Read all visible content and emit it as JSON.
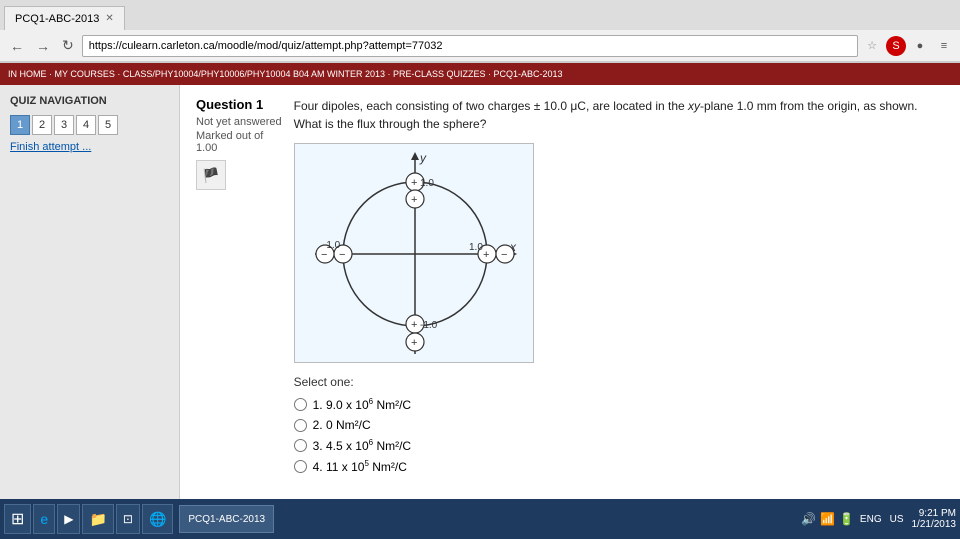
{
  "browser": {
    "tab_title": "PCQ1-ABC-2013",
    "url": "https://culearn.carleton.ca/moodle/mod/quiz/attempt.php?attempt=77032"
  },
  "breadcrumb": {
    "text": "IN HOME  ·  MY COURSES  ·  CLASS/PHY10004/PHY10006/PHY10004 B04 AM WINTER 2013  ·  PRE-CLASS QUIZZES  ·  PCQ1-ABC-2013"
  },
  "sidebar": {
    "title": "QUIZ NAVIGATION",
    "numbers": [
      "1",
      "2",
      "3",
      "4",
      "5"
    ],
    "finish_link": "Finish attempt ..."
  },
  "question": {
    "label": "Question",
    "number": "1",
    "not_answered": "Not yet answered",
    "marked_out": "Marked out of",
    "marked_value": "1.00",
    "text": "Four dipoles, each consisting of two charges ± 10.0 μC, are located in the xy-plane 1.0 mm from the origin, as shown. What is the flux through the sphere?",
    "select_label": "Select one:",
    "options": [
      {
        "id": "opt1",
        "label": "1. 9.0 x 10",
        "sup": "6",
        "suffix": " Nm²/C"
      },
      {
        "id": "opt2",
        "label": "2. 0 Nm²/C",
        "sup": "",
        "suffix": ""
      },
      {
        "id": "opt3",
        "label": "3. 4.5 x 10",
        "sup": "6",
        "suffix": " Nm²/C"
      },
      {
        "id": "opt4",
        "label": "4. 11 x 10",
        "sup": "5",
        "suffix": " Nm²/C"
      }
    ]
  },
  "taskbar": {
    "lang": "ENG",
    "region": "US",
    "time": "9:21 PM",
    "date": "1/21/2013"
  }
}
